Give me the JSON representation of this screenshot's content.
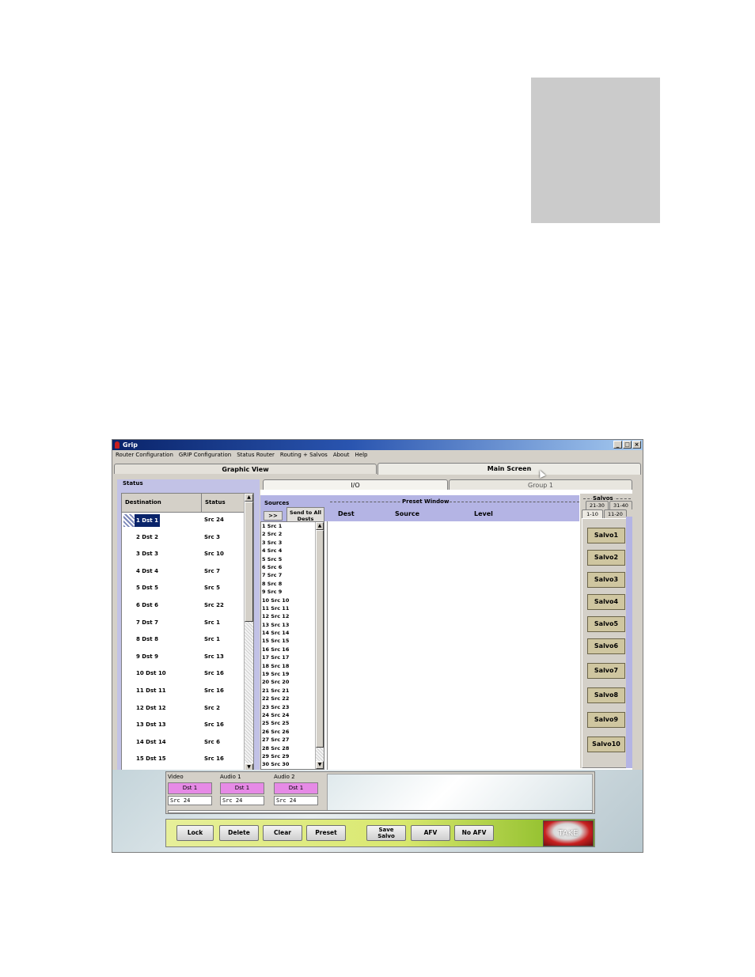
{
  "window": {
    "title": "Grip",
    "controls": [
      "_",
      "□",
      "×"
    ]
  },
  "menu": [
    "Router Configuration",
    "GRIP Configuration",
    "Status Router",
    "Routing + Salvos",
    "About",
    "Help"
  ],
  "tabs": {
    "graphic_view": "Graphic View",
    "main_screen": "Main Screen",
    "io": "I/O",
    "group1": "Group 1"
  },
  "status": {
    "title": "Status",
    "col_destination": "Destination",
    "col_status": "Status",
    "rows": [
      {
        "dest": "1 Dst 1",
        "src": "Src 24"
      },
      {
        "dest": "2 Dst 2",
        "src": "Src 3"
      },
      {
        "dest": "3 Dst 3",
        "src": "Src 10"
      },
      {
        "dest": "4 Dst 4",
        "src": "Src 7"
      },
      {
        "dest": "5 Dst 5",
        "src": "Src 5"
      },
      {
        "dest": "6 Dst 6",
        "src": "Src 22"
      },
      {
        "dest": "7 Dst 7",
        "src": "Src 1"
      },
      {
        "dest": "8 Dst 8",
        "src": "Src 1"
      },
      {
        "dest": "9 Dst 9",
        "src": "Src 13"
      },
      {
        "dest": "10 Dst 10",
        "src": "Src 16"
      },
      {
        "dest": "11 Dst 11",
        "src": "Src 16"
      },
      {
        "dest": "12 Dst 12",
        "src": "Src 2"
      },
      {
        "dest": "13 Dst 13",
        "src": "Src 16"
      },
      {
        "dest": "14 Dst 14",
        "src": "Src 6"
      },
      {
        "dest": "15 Dst 15",
        "src": "Src 16"
      }
    ]
  },
  "sources": {
    "title": "Sources",
    "arrow_label": ">>",
    "send_all_label": "Send to All Dests",
    "items": [
      "1 Src 1",
      "2 Src 2",
      "3 Src 3",
      "4 Src 4",
      "5 Src 5",
      "6 Src 6",
      "7 Src 7",
      "8 Src 8",
      "9 Src 9",
      "10 Src 10",
      "11 Src 11",
      "12 Src 12",
      "13 Src 13",
      "14 Src 14",
      "15 Src 15",
      "16 Src 16",
      "17 Src 17",
      "18 Src 18",
      "19 Src 19",
      "20 Src 20",
      "21 Src 21",
      "22 Src 22",
      "23 Src 23",
      "24 Src 24",
      "25 Src 25",
      "26 Src 26",
      "27 Src 27",
      "28 Src 28",
      "29 Src 29",
      "30 Src 30"
    ]
  },
  "preset": {
    "title": "Preset Window",
    "col_dest": "Dest",
    "col_source": "Source",
    "col_level": "Level"
  },
  "salvos": {
    "title": "Salvos",
    "tabs": [
      "21-30",
      "31-40",
      "1-10",
      "11-20"
    ],
    "buttons": [
      "Salvo1",
      "Salvo2",
      "Salvo3",
      "Salvo4",
      "Salvo5",
      "Salvo6",
      "Salvo7",
      "Salvo8",
      "Salvo9",
      "Salvo10"
    ]
  },
  "buses": [
    {
      "name": "Video",
      "dst": "Dst 1",
      "src": "Src 24"
    },
    {
      "name": "Audio 1",
      "dst": "Dst 1",
      "src": "Src 24"
    },
    {
      "name": "Audio 2",
      "dst": "Dst 1",
      "src": "Src 24"
    }
  ],
  "controls": {
    "lock": "Lock",
    "delete": "Delete",
    "clear": "Clear",
    "preset": "Preset",
    "save_salvo_1": "Save",
    "save_salvo_2": "Salvo",
    "afv": "AFV",
    "no_afv": "No AFV",
    "take": "TAKE"
  },
  "colors": {
    "titlebar": "#0a246a",
    "panel_lavender": "#b4b4e4",
    "bus_dst_magenta": "#e68ae6",
    "salvo_button": "#cfc6a0",
    "take_red": "#c82020"
  }
}
